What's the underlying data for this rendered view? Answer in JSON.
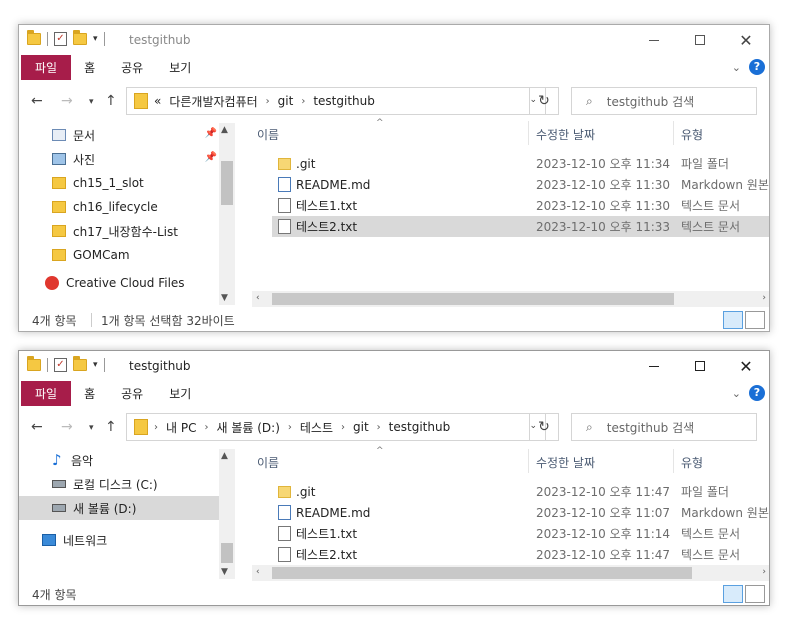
{
  "window1": {
    "title": "testgithub",
    "ribbon_tabs": [
      "파일",
      "홈",
      "공유",
      "보기"
    ],
    "breadcrumb": [
      "«",
      "다른개발자컴퓨터",
      "git",
      "testgithub"
    ],
    "search_placeholder": "testgithub 검색",
    "nav_items": [
      {
        "label": "문서",
        "icon": "document-icon",
        "pinned": true
      },
      {
        "label": "사진",
        "icon": "pictures-icon",
        "pinned": true
      },
      {
        "label": "ch15_1_slot",
        "icon": "folder-icon"
      },
      {
        "label": "ch16_lifecycle",
        "icon": "folder-icon"
      },
      {
        "label": "ch17_내장함수-List",
        "icon": "folder-icon"
      },
      {
        "label": "GOMCam",
        "icon": "folder-icon"
      },
      {
        "label": "Creative Cloud Files",
        "icon": "creative-cloud-icon"
      }
    ],
    "columns": [
      "이름",
      "수정한 날짜",
      "유형"
    ],
    "files": [
      {
        "name": ".git",
        "date": "2023-12-10 오후 11:34",
        "type": "파일 폴더",
        "icon": "folder"
      },
      {
        "name": "README.md",
        "date": "2023-12-10 오후 11:30",
        "type": "Markdown 원본 ...",
        "icon": "md"
      },
      {
        "name": "테스트1.txt",
        "date": "2023-12-10 오후 11:30",
        "type": "텍스트 문서",
        "icon": "txt"
      },
      {
        "name": "테스트2.txt",
        "date": "2023-12-10 오후 11:33",
        "type": "텍스트 문서",
        "icon": "txt",
        "selected": true
      }
    ],
    "status_count": "4개 항목",
    "status_selection": "1개 항목 선택함 32바이트"
  },
  "window2": {
    "title": "testgithub",
    "ribbon_tabs": [
      "파일",
      "홈",
      "공유",
      "보기"
    ],
    "breadcrumb": [
      "내 PC",
      "새 볼륨 (D:)",
      "테스트",
      "git",
      "testgithub"
    ],
    "search_placeholder": "testgithub 검색",
    "nav_items": [
      {
        "label": "음악",
        "icon": "music-icon"
      },
      {
        "label": "로컬 디스크 (C:)",
        "icon": "drive-icon"
      },
      {
        "label": "새 볼륨 (D:)",
        "icon": "drive-icon",
        "selected": true
      },
      {
        "label": "네트워크",
        "icon": "network-icon"
      }
    ],
    "columns": [
      "이름",
      "수정한 날짜",
      "유형"
    ],
    "files": [
      {
        "name": ".git",
        "date": "2023-12-10 오후 11:47",
        "type": "파일 폴더",
        "icon": "folder"
      },
      {
        "name": "README.md",
        "date": "2023-12-10 오후 11:07",
        "type": "Markdown 원본 ...",
        "icon": "md"
      },
      {
        "name": "테스트1.txt",
        "date": "2023-12-10 오후 11:14",
        "type": "텍스트 문서",
        "icon": "txt"
      },
      {
        "name": "테스트2.txt",
        "date": "2023-12-10 오후 11:47",
        "type": "텍스트 문서",
        "icon": "txt"
      }
    ],
    "status_count": "4개 항목"
  },
  "colors": {
    "file_tab": "#a71d4a",
    "selection": "#d9d9d9",
    "nav_selection": "#cce8ff",
    "help": "#1a6fd6"
  }
}
